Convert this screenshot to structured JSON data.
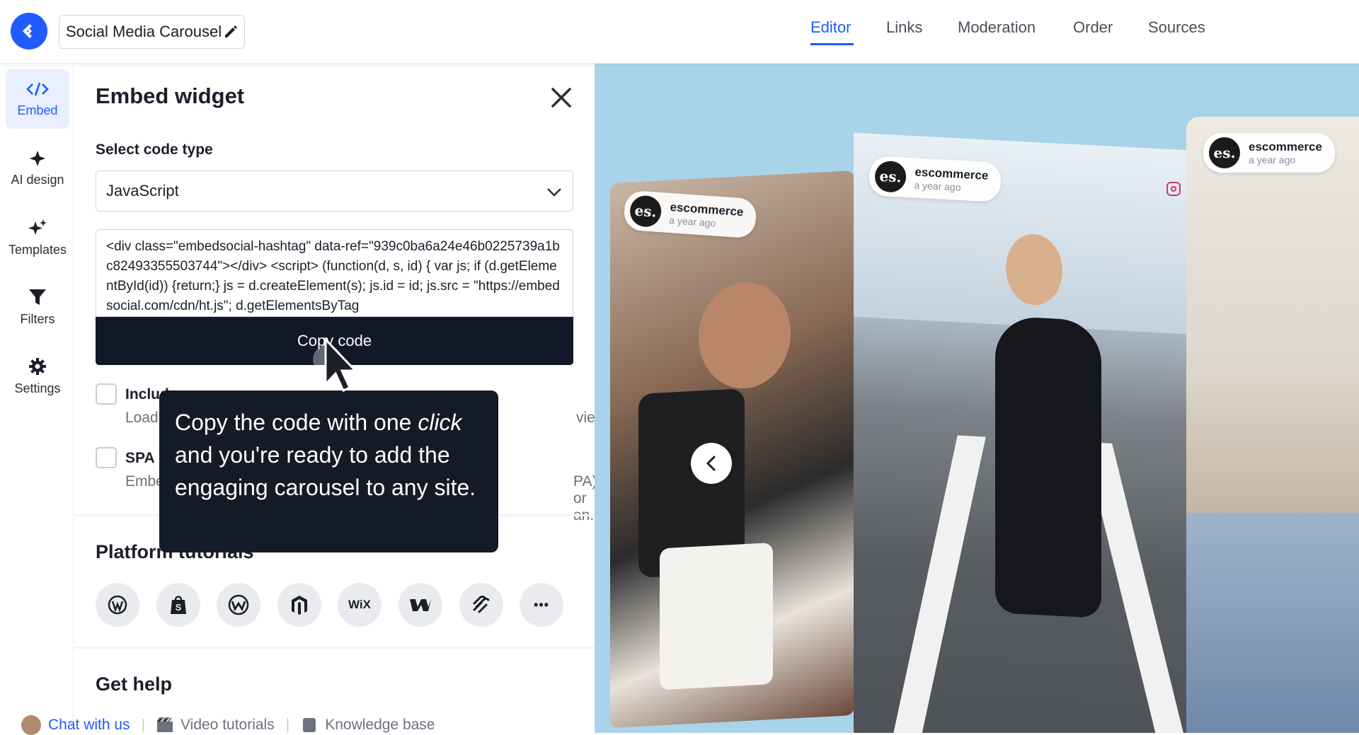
{
  "header": {
    "widget_title": "Social Media Carousel",
    "tabs": [
      {
        "label": "Editor",
        "active": true
      },
      {
        "label": "Links"
      },
      {
        "label": "Moderation"
      },
      {
        "label": "Order"
      },
      {
        "label": "Sources"
      }
    ]
  },
  "sidebar": {
    "items": [
      {
        "label": "Embed",
        "icon": "code-icon",
        "active": true
      },
      {
        "label": "AI design",
        "icon": "sparkle-icon"
      },
      {
        "label": "Templates",
        "icon": "sparkles-icon"
      },
      {
        "label": "Filters",
        "icon": "filter-icon"
      },
      {
        "label": "Settings",
        "icon": "gear-icon"
      }
    ]
  },
  "panel": {
    "title": "Embed widget",
    "select_label": "Select code type",
    "select_value": "JavaScript",
    "code": "<div class=\"embedsocial-hashtag\" data-ref=\"939c0ba6a24e46b0225739a1bc82493355503744\"></div> <script> (function(d, s, id) { var js; if (d.getElementById(id)) {return;} js = d.createElement(s); js.id = id; js.src = \"https://embedsocial.com/cdn/ht.js\"; d.getElementsByTag",
    "copy_button": "Copy code",
    "options": [
      {
        "title": "Includ",
        "desc": "Load",
        "tail": "view."
      },
      {
        "title": "SPA",
        "desc": "Embe",
        "tail": "PA) or an..."
      }
    ],
    "platform_title": "Platform tutorials",
    "platforms": [
      "wordpress-icon",
      "shopify-icon",
      "webflow-icon",
      "magento-icon",
      "wix-icon",
      "webflow-w-icon",
      "squarespace-icon",
      "more-icon"
    ],
    "wix_label": "WiX",
    "more_label": "•••",
    "help_title": "Get help",
    "help_links": {
      "chat": "Chat with us",
      "video": "Video tutorials",
      "kb": "Knowledge base"
    }
  },
  "tooltip": {
    "line1": "Copy the code with one ",
    "emph": "click",
    "rest": " and you're ready to add the engaging carousel to any site."
  },
  "preview": {
    "posts": [
      {
        "name": "escommerce",
        "time": "a year ago"
      },
      {
        "name": "escommerce",
        "time": "a year ago"
      },
      {
        "name": "escommerce",
        "time": "a year ago"
      }
    ],
    "avatar_text": "es."
  }
}
